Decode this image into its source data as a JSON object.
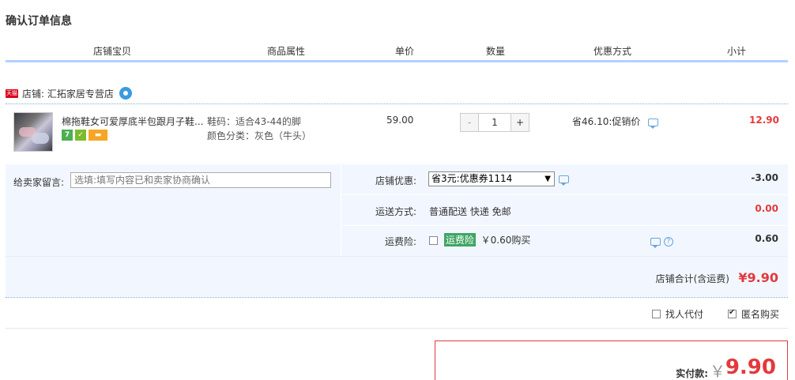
{
  "page": {
    "title": "确认订单信息"
  },
  "columns": [
    "店铺宝贝",
    "商品属性",
    "单价",
    "数量",
    "优惠方式",
    "小计"
  ],
  "shop": {
    "badge": "天猫",
    "label": "店铺: 汇拓家居专营店",
    "chat_icon": "wangwang-icon"
  },
  "item": {
    "title": "棉拖鞋女可爱厚底半包跟月子鞋...",
    "badges": [
      "7",
      "shield",
      "card"
    ],
    "attr_size": "鞋码：适合43-44的脚",
    "attr_color": "颜色分类：灰色（牛头）",
    "unit_price": "59.00",
    "quantity": "1",
    "minus": "-",
    "plus": "+",
    "promo": "省46.10:促销价",
    "subtotal": "12.90"
  },
  "options": {
    "message_label": "给卖家留言:",
    "message_placeholder": "选填:填写内容已和卖家协商确认",
    "shop_discount_label": "店铺优惠:",
    "shop_discount_value": "省3元:优惠券1114",
    "shop_discount_amount": "-3.00",
    "shipping_label": "运送方式:",
    "shipping_value": "普通配送 快递 免邮",
    "shipping_amount": "0.00",
    "insurance_label": "运费险:",
    "insurance_tag": "运费险",
    "insurance_value": "￥0.60购买",
    "insurance_amount": "0.60",
    "shop_total_label": "店铺合计(含运费)",
    "shop_total_amount": "¥9.90"
  },
  "extras": {
    "proxy_label": "找人代付",
    "proxy_checked": false,
    "anonymous_label": "匿名购买",
    "anonymous_checked": true
  },
  "payment": {
    "label": "实付款:",
    "currency": "￥",
    "amount": "9.90"
  },
  "colors": {
    "accent_red": "#e4393c",
    "header_line": "#b2d1ff",
    "option_bg": "#f2f7ff",
    "insurance_green": "#3fa563"
  }
}
